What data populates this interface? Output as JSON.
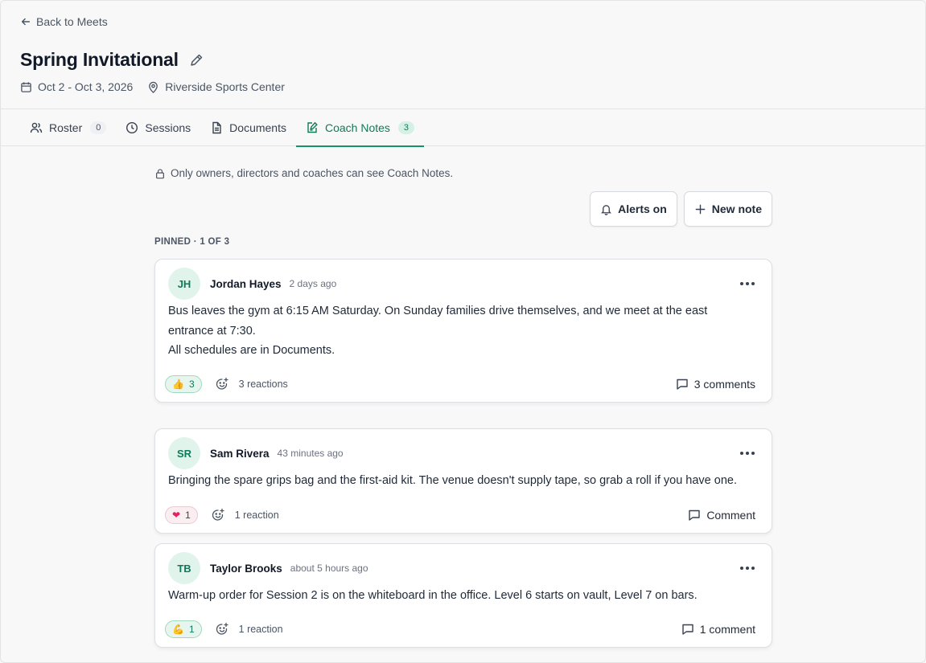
{
  "header": {
    "back_label": "Back to Meets",
    "title": "Spring Invitational",
    "dates": "Oct 2 - Oct 3, 2026",
    "location": "Riverside Sports Center"
  },
  "tabs": [
    {
      "label": "Roster",
      "count": "0",
      "icon": "users-icon"
    },
    {
      "label": "Sessions",
      "icon": "clock-icon"
    },
    {
      "label": "Documents",
      "icon": "document-icon"
    },
    {
      "label": "Coach Notes",
      "count": "3",
      "icon": "note-edit-icon",
      "active": true
    }
  ],
  "notes_panel": {
    "privacy_text": "Only owners, directors and coaches can see Coach Notes.",
    "alerts_label": "Alerts on",
    "new_note_label": "New note",
    "pinned_label": "PINNED · 1 OF 3"
  },
  "notes": [
    {
      "initials": "JH",
      "author": "Jordan Hayes",
      "time": "2 days ago",
      "lines": [
        "Bus leaves the gym at 6:15 AM Saturday. On Sunday families drive themselves, and we meet at the east",
        "entrance at 7:30.",
        "All schedules are in Documents."
      ],
      "reaction_emoji": "👍",
      "reaction_count": "3",
      "reactions_text": "3 reactions",
      "comment_label": "3 comments"
    },
    {
      "initials": "SR",
      "author": "Sam Rivera",
      "time": "43 minutes ago",
      "lines": [
        "Bringing the spare grips bag and the first-aid kit. The venue doesn't supply tape, so grab a roll if you have one."
      ],
      "reaction_emoji": "❤",
      "reaction_count": "1",
      "reactions_text": "1 reaction",
      "comment_label": "Comment"
    },
    {
      "initials": "TB",
      "author": "Taylor Brooks",
      "time": "about 5 hours ago",
      "lines": [
        "Warm-up order for Session 2 is on the whiteboard in the office. Level 6 starts on vault, Level 7 on bars."
      ],
      "reaction_emoji": "💪",
      "reaction_count": "1",
      "reactions_text": "1 reaction",
      "comment_label": "1 comment"
    }
  ],
  "colors": {
    "accent": "#15936b",
    "accent_text": "#0f7a5a",
    "avatar_bg": "#e0f4ec"
  }
}
